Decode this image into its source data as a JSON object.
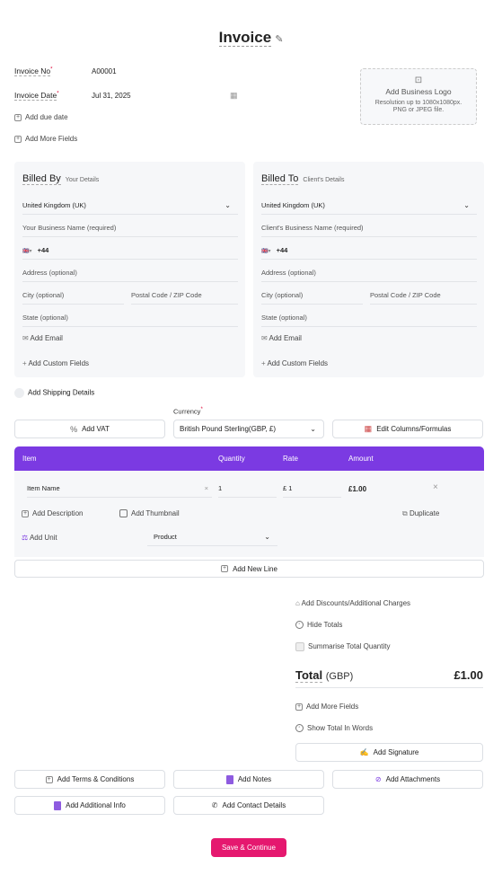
{
  "header": {
    "title": "Invoice"
  },
  "meta": {
    "invoice_no_label": "Invoice No",
    "invoice_no_value": "A00001",
    "invoice_date_label": "Invoice Date",
    "invoice_date_value": "Jul 31, 2025",
    "add_due_date": "Add due date",
    "add_more_fields": "Add More Fields"
  },
  "logo": {
    "title": "Add Business Logo",
    "desc1": "Resolution up to 1080x1080px.",
    "desc2": "PNG or JPEG file."
  },
  "billed_by": {
    "title": "Billed By",
    "subtitle": "Your Details",
    "country": "United Kingdom (UK)",
    "business_name_placeholder": "Your Business Name (required)",
    "phone_code": "+44",
    "address_placeholder": "Address (optional)",
    "city_placeholder": "City (optional)",
    "postal_placeholder": "Postal Code / ZIP Code",
    "state_placeholder": "State (optional)",
    "add_email": "Add Email",
    "add_custom": "Add Custom Fields"
  },
  "billed_to": {
    "title": "Billed To",
    "subtitle": "Client's Details",
    "country": "United Kingdom (UK)",
    "business_name_placeholder": "Client's Business Name (required)",
    "phone_code": "+44",
    "address_placeholder": "Address (optional)",
    "city_placeholder": "City (optional)",
    "postal_placeholder": "Postal Code / ZIP Code",
    "state_placeholder": "State (optional)",
    "add_email": "Add Email",
    "add_custom": "Add Custom Fields"
  },
  "shipping": {
    "label": "Add Shipping Details"
  },
  "currency": {
    "label": "Currency",
    "value": "British Pound Sterling(GBP, £)"
  },
  "toolbar": {
    "add_vat": "Add VAT",
    "edit_columns": "Edit Columns/Formulas"
  },
  "table": {
    "headers": {
      "item": "Item",
      "quantity": "Quantity",
      "rate": "Rate",
      "amount": "Amount"
    },
    "row": {
      "item_name": "Item Name",
      "quantity": "1",
      "rate_symbol": "£",
      "rate": "1",
      "amount": "£1.00",
      "add_description": "Add Description",
      "add_thumbnail": "Add Thumbnail",
      "duplicate": "Duplicate",
      "add_unit": "Add Unit",
      "unit_type": "Product"
    },
    "add_new_line": "Add New Line"
  },
  "totals": {
    "add_discounts": "Add Discounts/Additional Charges",
    "hide_totals": "Hide Totals",
    "summarise_qty": "Summarise Total Quantity",
    "total_label": "Total",
    "total_currency": "(GBP)",
    "total_value": "£1.00",
    "add_more_fields": "Add More Fields",
    "show_in_words": "Show Total In Words",
    "add_signature": "Add Signature"
  },
  "footer_buttons": {
    "terms": "Add Terms & Conditions",
    "notes": "Add Notes",
    "attachments": "Add Attachments",
    "additional_info": "Add Additional Info",
    "contact": "Add Contact Details"
  },
  "actions": {
    "save": "Save & Continue"
  },
  "colors": {
    "accent": "#7b3ae2",
    "primary_button": "#e5186f"
  }
}
